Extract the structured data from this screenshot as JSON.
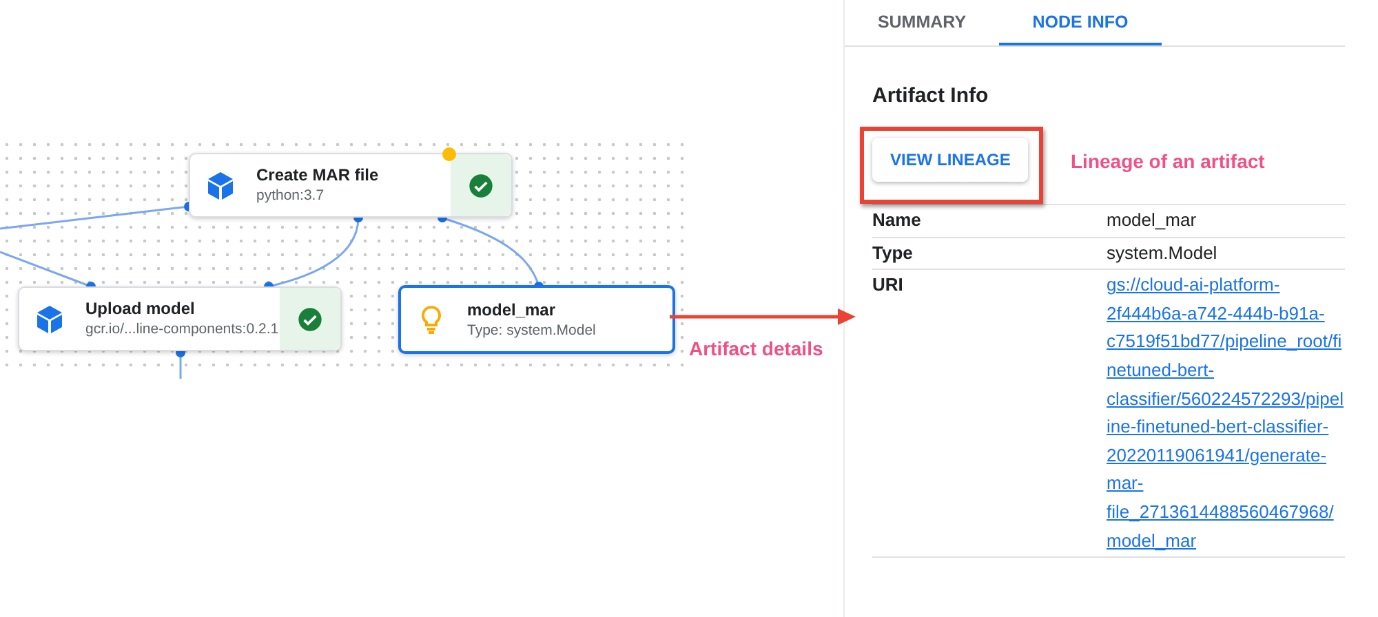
{
  "graph": {
    "nodes": [
      {
        "kind": "step",
        "title": "Create MAR file",
        "subtitle": "python:3.7",
        "succeeded": true,
        "pending_dot": true,
        "selected": false
      },
      {
        "kind": "step",
        "title": "Upload model",
        "subtitle": "gcr.io/...line-components:0.2.1",
        "succeeded": true,
        "pending_dot": false,
        "selected": false
      },
      {
        "kind": "artifact",
        "title": "model_mar",
        "subtitle": "Type: system.Model",
        "succeeded": false,
        "pending_dot": false,
        "selected": true
      }
    ]
  },
  "annotations": [
    {
      "kind": "arrow",
      "label": "Artifact details"
    },
    {
      "kind": "box",
      "label": "Lineage of an artifact"
    }
  ],
  "tabs": [
    {
      "label": "SUMMARY",
      "selected": false
    },
    {
      "label": "NODE INFO",
      "selected": true
    }
  ],
  "panel": {
    "heading": "Artifact Info",
    "button": "VIEW LINEAGE",
    "rows": [
      {
        "label": "Name",
        "value": "model_mar",
        "link": false
      },
      {
        "label": "Type",
        "value": "system.Model",
        "link": false
      },
      {
        "label": "URI",
        "value": "gs://cloud-ai-platform-2f444b6a-a742-444b-b91a-c7519f51bd77/pipeline_root/finetuned-bert-classifier/560224572293/pipeline-finetuned-bert-classifier-20220119061941/generate-mar-file_2713614488560467968/model_mar",
        "link": true
      }
    ]
  }
}
